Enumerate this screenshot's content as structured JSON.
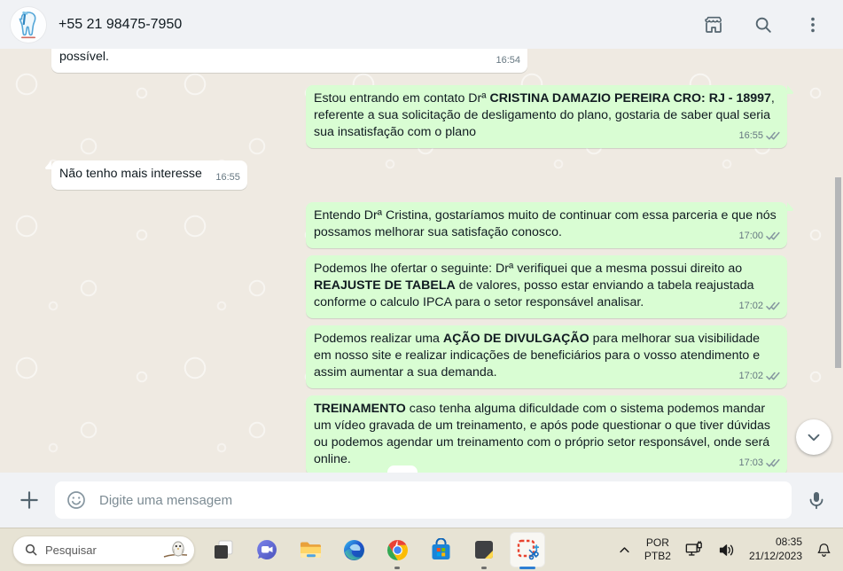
{
  "header": {
    "title": "+55 21 98475-7950",
    "icons": [
      "catalog-storefront",
      "search",
      "kebab-menu"
    ]
  },
  "chat": {
    "messages": [
      {
        "dir": "in",
        "variant": "clipped",
        "group": true,
        "segments": [
          {
            "text": "possível."
          }
        ],
        "time": "16:54"
      },
      {
        "dir": "out",
        "group": true,
        "tail": true,
        "segments": [
          {
            "text": "Estou entrando em contato Drª  "
          },
          {
            "text": "CRISTINA DAMAZIO PEREIRA CRO: RJ - 18997",
            "bold": true
          },
          {
            "text": ", referente a sua solicitação de desligamento do plano, gostaria de saber qual seria sua insatisfação com o plano"
          }
        ],
        "time": "16:55",
        "ticks": "delivered"
      },
      {
        "dir": "in",
        "group": true,
        "tail": true,
        "segments": [
          {
            "text": "Não tenho mais interesse"
          }
        ],
        "time": "16:55"
      },
      {
        "dir": "out",
        "group": true,
        "tail": true,
        "segments": [
          {
            "text": "Entendo Drª Cristina, gostaríamos muito de continuar com essa parceria e que nós possamos melhorar sua satisfação conosco."
          }
        ],
        "time": "17:00",
        "ticks": "delivered"
      },
      {
        "dir": "out",
        "segments": [
          {
            "text": "Podemos lhe ofertar o seguinte: Drª verifiquei que a mesma possui direito ao "
          },
          {
            "text": "REAJUSTE DE TABELA",
            "bold": true
          },
          {
            "text": " de valores, posso estar enviando a tabela reajustada conforme o calculo IPCA para o setor responsável analisar."
          }
        ],
        "time": "17:02",
        "ticks": "delivered"
      },
      {
        "dir": "out",
        "segments": [
          {
            "text": "Podemos realizar uma "
          },
          {
            "text": "AÇÃO DE DIVULGAÇÃO",
            "bold": true
          },
          {
            "text": " para melhorar sua visibilidade em nosso site e realizar indicações de beneficiários para o vosso atendimento e assim aumentar a sua demanda."
          }
        ],
        "time": "17:02",
        "ticks": "delivered"
      },
      {
        "dir": "out",
        "segments": [
          {
            "text": "TREINAMENTO",
            "bold": true
          },
          {
            "text": " caso tenha alguma dificuldade com o sistema podemos mandar um vídeo gravada de um treinamento, e após pode questionar o que tiver dúvidas ou podemos agendar um treinamento com o próprio setor responsável, onde será online."
          }
        ],
        "time": "17:03",
        "ticks": "delivered"
      }
    ]
  },
  "composer": {
    "placeholder": "Digite uma mensagem"
  },
  "taskbar": {
    "search_label": "Pesquisar",
    "apps": [
      "task-view",
      "teams-chat",
      "file-explorer",
      "edge",
      "chrome",
      "microsoft-store",
      "notes-app",
      "snipping-tool-active"
    ],
    "tray": {
      "lang_line1": "POR",
      "lang_line2": "PTB2",
      "time": "08:35",
      "date": "21/12/2023"
    }
  },
  "colors": {
    "outgoing_bubble": "#D9FDD3",
    "incoming_bubble": "#FFFFFF",
    "chat_background": "#EFEAE2",
    "header_background": "#F0F2F5",
    "meta_text": "#667781",
    "taskbar_accent": "#2F7FD3"
  }
}
